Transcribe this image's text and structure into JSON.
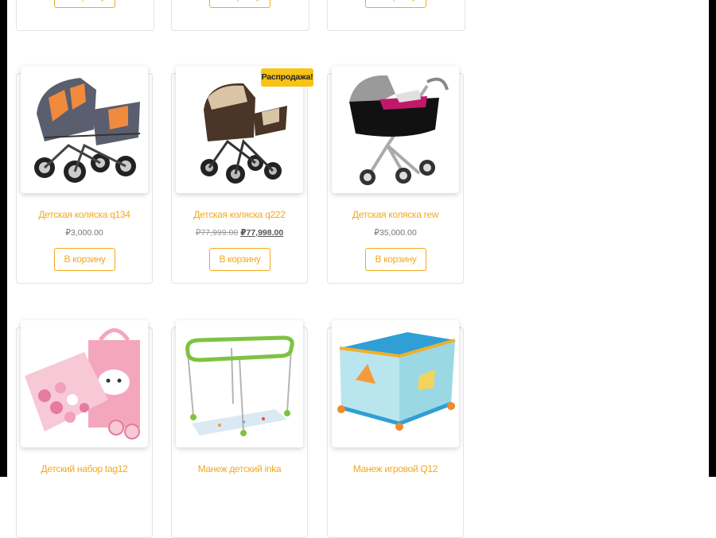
{
  "add_to_cart_label": "В корзину",
  "sale_badge": "Распродажа!",
  "colors": {
    "accent": "#f4a81c",
    "sale_badge_bg": "#f8c216"
  },
  "products": [
    {
      "name": "Детская коляска q134",
      "price": "₽3,000.00",
      "image": "stroller-orange-gray"
    },
    {
      "name": "Детская коляска q222",
      "old_price": "₽77,999.00",
      "price": "₽77,998.00",
      "on_sale": true,
      "image": "stroller-brown-beige"
    },
    {
      "name": "Детская коляска rew",
      "price": "₽35,000.00",
      "image": "stroller-gray-pink"
    },
    {
      "name": "Детский набор tag12",
      "image": "hair-accessory-set-pink"
    },
    {
      "name": "Манеж детский inka",
      "image": "playpen-green"
    },
    {
      "name": "Манеж игровой Q12",
      "image": "playpen-blue-orange"
    }
  ]
}
